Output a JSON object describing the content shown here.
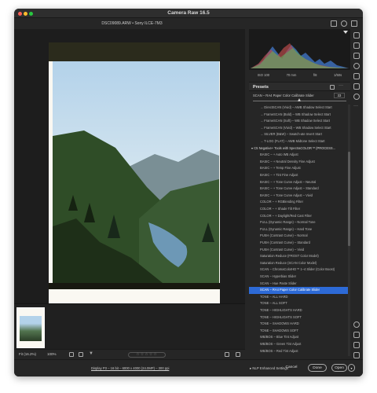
{
  "window": {
    "title": "Camera Raw 16.5"
  },
  "header": {
    "filename": "DSC09089.ARW  •  Sony ILCE-7M3"
  },
  "histogram": {
    "iso": "ISO 100",
    "focal": "70 mm",
    "aperture": "f/8",
    "shutter": "1/50s"
  },
  "presets": {
    "title": "Presets",
    "amount_label": "SCAN – RA4 Paper Color Calibrate Slider",
    "amount_value": "33",
    "items": [
      {
        "label": "→ DirectSCAN (Vivid) – AWB Shadow Select Start",
        "kind": "indent"
      },
      {
        "label": "→ FrameSCAN (Bold) – WB Shadow Select Start",
        "kind": "indent"
      },
      {
        "label": "→ FrameSCAN (Soft) – WB Shadow Select Start",
        "kind": "indent"
      },
      {
        "label": "→ FrameSCAN (Vivid) – WB Shadow Select Start",
        "kind": "indent"
      },
      {
        "label": "→ SILVER (B&W) – Swatch-ate Invert Start",
        "kind": "indent"
      },
      {
        "label": "→ T-LOG (FLAT) – AWB Midtone Select Start",
        "kind": "indent"
      },
      {
        "label": "▾ C5 Negative+ Tools with SpectraCOLOR™ (PROCESS...",
        "kind": "group"
      },
      {
        "label": "BASIC – + Auto WB Adjust",
        "kind": "item"
      },
      {
        "label": "BASIC – + Neutral Density Fine Adjust",
        "kind": "item"
      },
      {
        "label": "BASIC – + Temp Fine Adjust",
        "kind": "item"
      },
      {
        "label": "BASIC – + Tint Fine Adjust",
        "kind": "item"
      },
      {
        "label": "BASIC – + Tone Curve Adjust – Neutral",
        "kind": "item"
      },
      {
        "label": "BASIC – + Tone Curve Adjust – Standard",
        "kind": "item"
      },
      {
        "label": "BASIC – + Tone Curve Adjust – Vivid",
        "kind": "item"
      },
      {
        "label": "COLOR – + RGBlending Filter",
        "kind": "item"
      },
      {
        "label": "COLOR – + Shade Tilt Filter",
        "kind": "item"
      },
      {
        "label": "COLOR – + Daylight/Red Cast Filter",
        "kind": "item"
      },
      {
        "label": "FULL (Dynamic Range) – Normal Tone",
        "kind": "item"
      },
      {
        "label": "FULL (Dynamic Range) – Hard Tone",
        "kind": "item"
      },
      {
        "label": "PUSH (Contrast Curve) – Normal",
        "kind": "item"
      },
      {
        "label": "PUSH (Contrast Curve) – Standard",
        "kind": "item"
      },
      {
        "label": "PUSH (Contrast Curve) – Vivid",
        "kind": "item"
      },
      {
        "label": "Saturation Reduce (FROST Color Model)",
        "kind": "item"
      },
      {
        "label": "Saturation Reduce (SCAN Color Model)",
        "kind": "item"
      },
      {
        "label": "SCAN – ChromaColorHD™ 1–4 Slider (Color Boost)",
        "kind": "item"
      },
      {
        "label": "SCAN – Hyperbias Slider",
        "kind": "item"
      },
      {
        "label": "SCAN – Hue Paste Slider",
        "kind": "item"
      },
      {
        "label": "SCAN – RA4 Paper Color Calibrate Slider",
        "kind": "item",
        "selected": true
      },
      {
        "label": "TONE – ALL HARD",
        "kind": "item"
      },
      {
        "label": "TONE – ALL SOFT",
        "kind": "item"
      },
      {
        "label": "TONE – HIGHLIGHTS HARD",
        "kind": "item"
      },
      {
        "label": "TONE – HIGHLIGHTS SOFT",
        "kind": "item"
      },
      {
        "label": "TONE – SHADOWS HARD",
        "kind": "item"
      },
      {
        "label": "TONE – SHADOWS SOFT",
        "kind": "item"
      },
      {
        "label": "WB/BOS – Blue Tint Adjust",
        "kind": "item"
      },
      {
        "label": "WB/BOS – Green Tint Adjust",
        "kind": "item"
      },
      {
        "label": "WB/BOS – Red Tint Adjust",
        "kind": "item"
      }
    ],
    "collapsed_group": "▸  NLP Enhanced Settings"
  },
  "status": {
    "fit": "Fit (16.2%)",
    "zoom": "100%"
  },
  "footer": {
    "info_link": "Display P3 – 16 bit – 6000 x 4000 (24.0MP) – 300 ppi",
    "cancel": "Cancel",
    "done": "Done",
    "open": "Open"
  }
}
